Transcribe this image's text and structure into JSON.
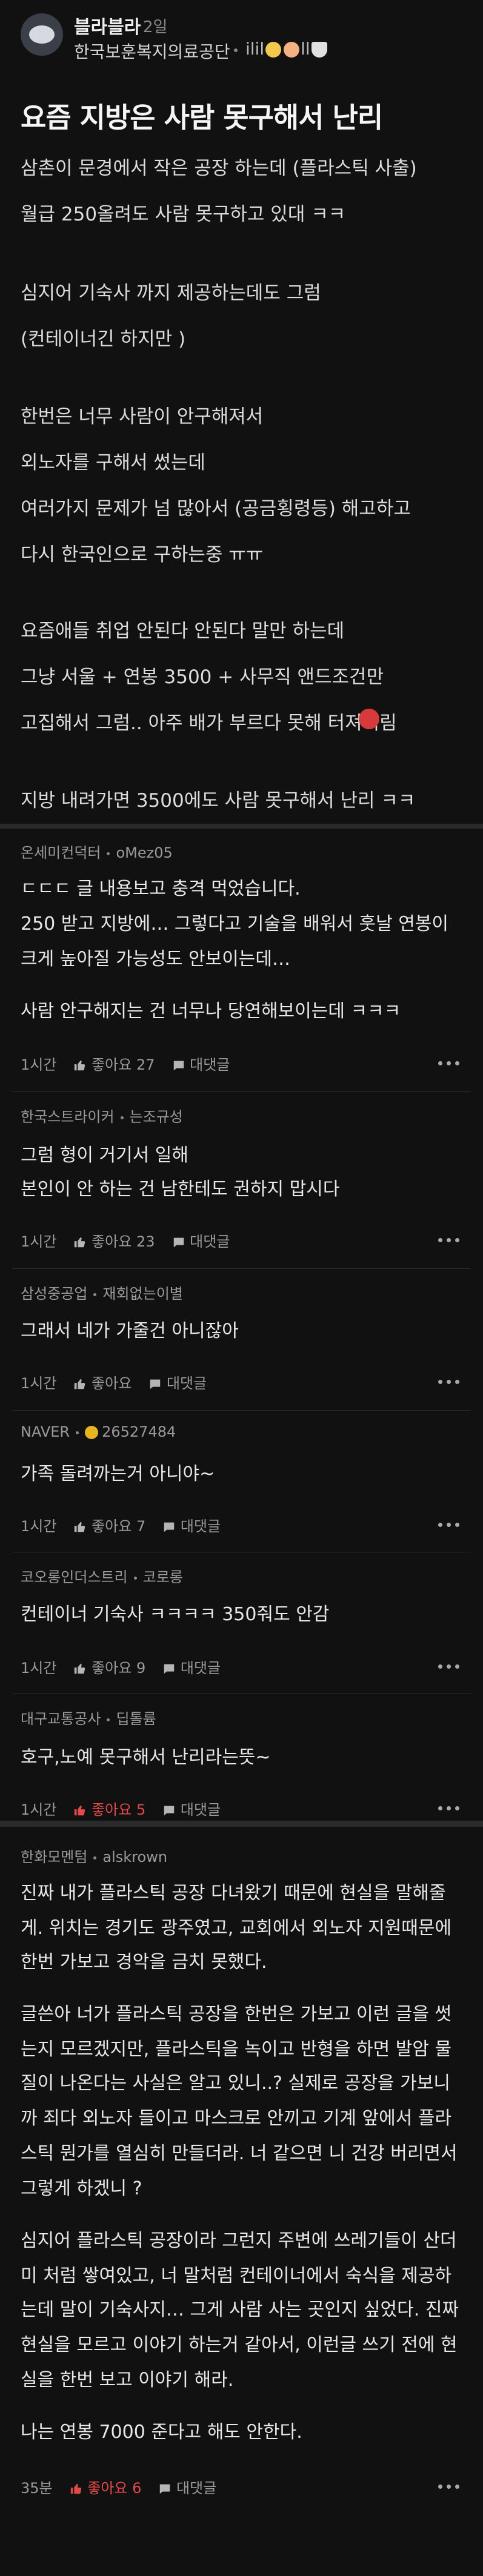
{
  "post": {
    "author": "블라블라",
    "ago": "2일",
    "company": "한국보훈복지의료공단",
    "nickname": "ilil",
    "nickname_tail": "ll",
    "title": "요즘 지방은 사람 못구해서 난리",
    "lines": [
      "삼촌이 문경에서 작은 공장 하는데 (플라스틱 사출)",
      "월급 250올려도 사람 못구하고 있대 ㅋㅋ",
      "",
      "심지어 기숙사 까지 제공하는데도 그럼",
      "(컨테이너긴 하지만 )",
      "",
      "한번은 너무 사람이 안구해져서",
      "외노자를 구해서 썼는데",
      "여러가지 문제가 넘 많아서 (공금횡령등) 해고하고",
      "다시 한국인으로 구하는중 ㅠㅠ",
      "",
      "요즘애들 취업 안된다 안된다 말만 하는데",
      "그냥 서울 + 연봉 3500 + 사무직 앤드조건만",
      "고집해서 그럼.. 아주 배가 부르다 못해 터져버림",
      "",
      "지방 내려가면 3500에도 사람 못구해서 난리 ㅋㅋ"
    ]
  },
  "threads": [
    {
      "comments": [
        {
          "company": "온세미컨덕터",
          "nickname": "oMez05",
          "lines": [
            "ㄷㄷㄷ 글 내용보고 충격 먹었습니다.",
            "250 받고 지방에… 그렇다고 기술을 배워서 훗날 연봉이",
            "크게 높아질 가능성도 안보이는데…",
            "",
            "사람 안구해지는 건 너무나 당연해보이는데 ㅋㅋㅋ"
          ],
          "time": "1시간",
          "like": "좋아요 27",
          "reply": "대댓글",
          "liked": false
        },
        {
          "company": "한국스트라이커",
          "nickname": "는조규성",
          "lines": [
            "그럼 형이 거기서 일해",
            "본인이 안 하는 건 남한테도 권하지 맙시다"
          ],
          "time": "1시간",
          "like": "좋아요 23",
          "reply": "대댓글",
          "liked": false
        },
        {
          "company": "삼성중공업",
          "nickname": "재회없는이별",
          "lines": [
            "그래서 네가 가줄건 아니잖아"
          ],
          "time": "1시간",
          "like": "좋아요",
          "reply": "대댓글",
          "liked": false
        },
        {
          "company": "NAVER",
          "nickname": "26527484",
          "lines": [
            "가족 돌려까는거 아니야~"
          ],
          "time": "1시간",
          "like": "좋아요 7",
          "reply": "대댓글",
          "liked": false
        },
        {
          "company": "코오롱인더스트리",
          "nickname": "코로롱",
          "lines": [
            "컨테이너 기숙사 ㅋㅋㅋㅋ 350줘도 안감"
          ],
          "time": "1시간",
          "like": "좋아요 9",
          "reply": "대댓글",
          "liked": false
        },
        {
          "company": "대구교통공사",
          "nickname": "딥톨륨",
          "lines": [
            "호구,노예 못구해서 난리라는뜻~"
          ],
          "time": "1시간",
          "like": "좋아요 5",
          "reply": "대댓글",
          "liked": true
        }
      ]
    },
    {
      "comments": [
        {
          "company": "한화모멘텀",
          "nickname": "alskrown",
          "lines": [
            "진짜 내가 플라스틱 공장 다녀왔기 때문에 현실을 말해줄",
            "게. 위치는 경기도 광주였고, 교회에서 외노자 지원때문에",
            "한번 가보고 경악을 금치 못했다.",
            "",
            "글쓴아 너가 플라스틱 공장을 한번은 가보고 이런 글을 썻",
            "는지 모르겠지만, 플라스틱을 녹이고 반형을 하면 발암 물",
            "질이 나온다는 사실은 알고 있니..? 실제로 공장을 가보니",
            "까 죄다 외노자 들이고 마스크로 안끼고 기계 앞에서 플라",
            "스틱 뭔가를 열심히 만들더라. 너 같으면 니 건강 버리면서",
            "그렇게 하겠니 ?",
            "",
            "심지어 플라스틱 공장이라 그런지 주변에 쓰레기들이 산더",
            "미 처럼 쌓여있고, 너 말처럼 컨테이너에서 숙식을 제공하",
            "는데 말이 기숙사지… 그게 사람 사는 곳인지 싶었다. 진짜",
            "현실을 모르고 이야기 하는거 같아서, 이런글 쓰기 전에 현",
            "실을 한번 보고 이야기 해라.",
            "",
            "나는 연봉 7000 준다고 해도 안한다."
          ],
          "time": "35분",
          "like": "좋아요 6",
          "reply": "대댓글",
          "liked": true
        }
      ]
    }
  ],
  "colors": {
    "background": "#111111",
    "separator": "#2a2a2a",
    "liked": "#e54848",
    "muted": "#9a9a9a"
  },
  "icons": [
    "avatar-icon",
    "thumb-up-icon",
    "comment-icon",
    "more-icon",
    "angry-face-icon",
    "smile-emoji",
    "blush-emoji",
    "rice-bowl-emoji",
    "gold-badge-icon"
  ]
}
